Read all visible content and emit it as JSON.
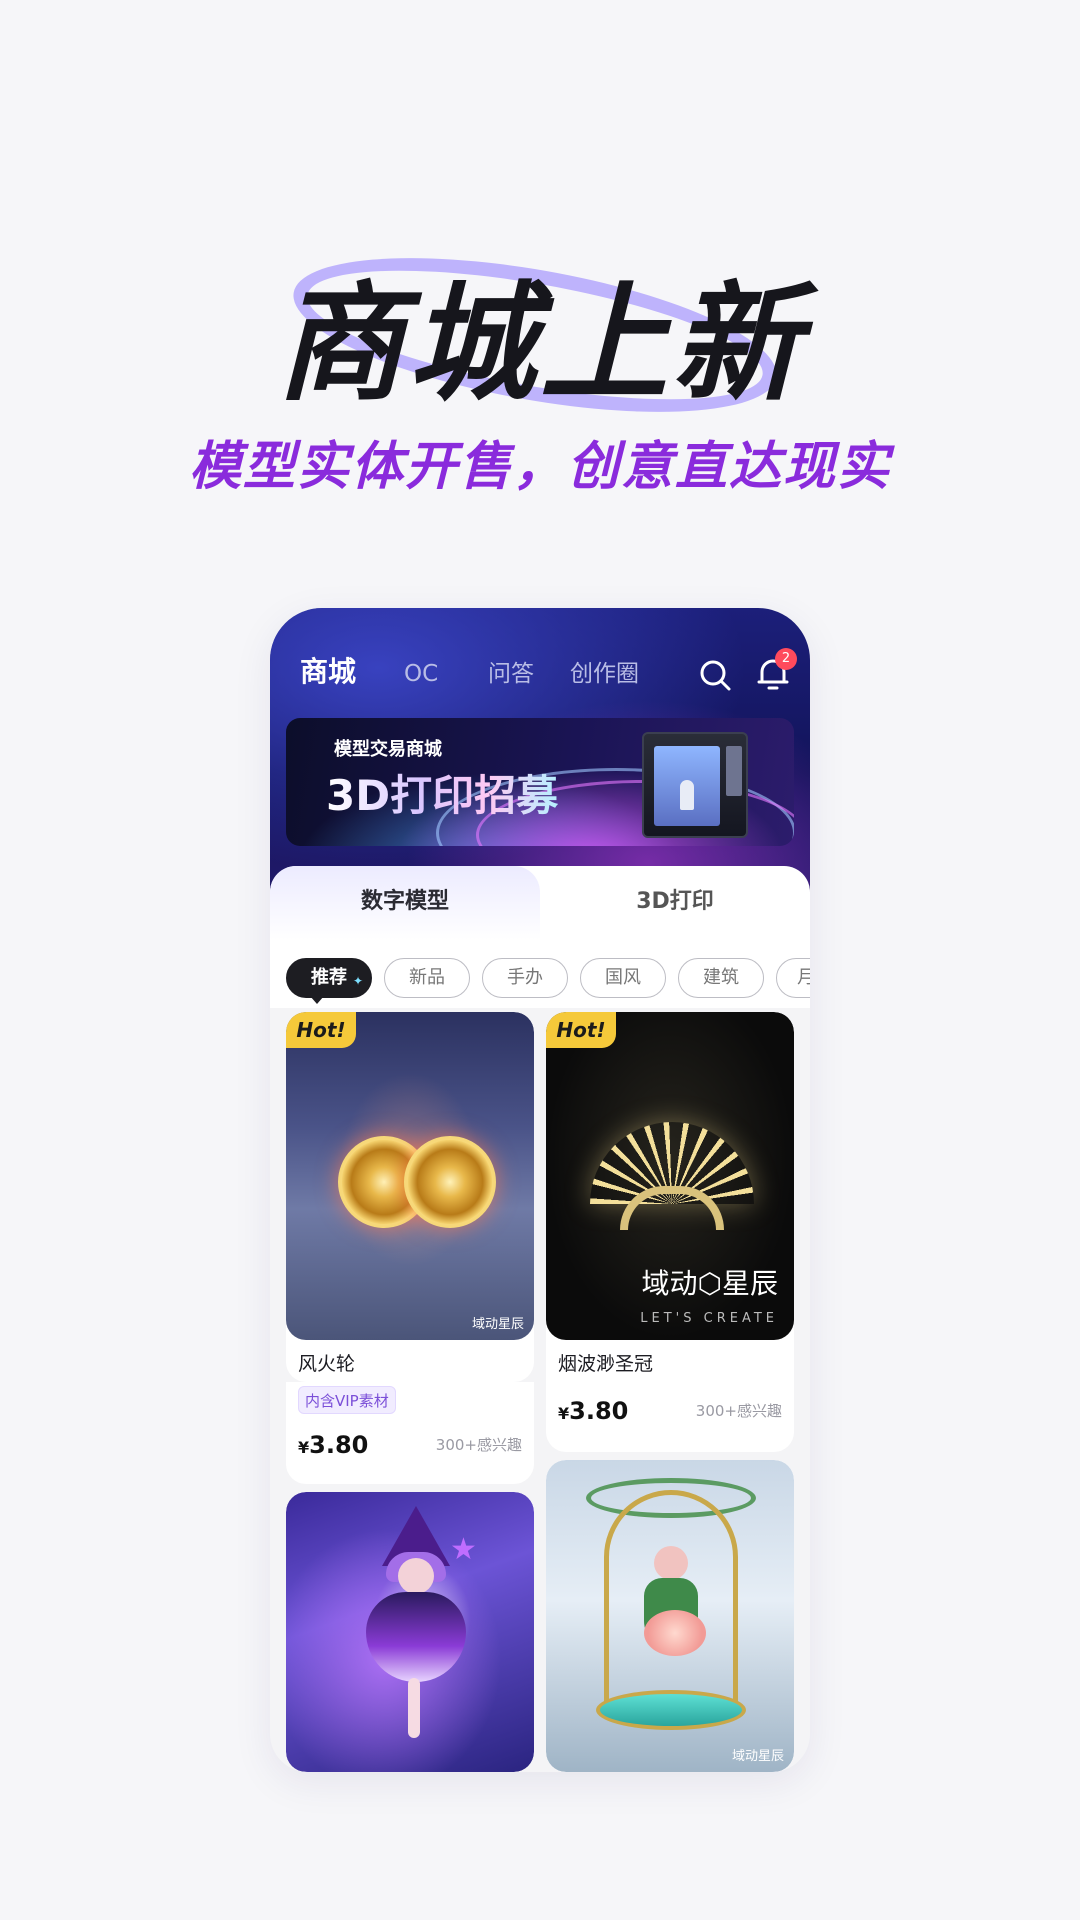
{
  "promo": {
    "title": "商城上新",
    "subtitle": "模型实体开售，创意直达现实"
  },
  "topnav": {
    "tabs": [
      {
        "label": "商城",
        "active": true
      },
      {
        "label": "OC"
      },
      {
        "label": "问答"
      },
      {
        "label": "创作圈"
      }
    ],
    "search_icon": "search-icon",
    "bell_icon": "bell-icon",
    "notification_count": "2"
  },
  "banner": {
    "small_text": "模型交易商城",
    "big_text": "3D打印招募"
  },
  "category_tabs": [
    {
      "label": "数字模型",
      "active": true
    },
    {
      "label": "3D打印"
    }
  ],
  "filters": [
    "推荐",
    "新品",
    "手办",
    "国风",
    "建筑",
    "月"
  ],
  "products": [
    {
      "hot": "Hot!",
      "title": "风火轮",
      "tag": "内含VIP素材",
      "price_symbol": "¥",
      "price": "3.80",
      "interest": "300+感兴趣",
      "watermark": "域动星辰"
    },
    {
      "hot": "Hot!",
      "title": "烟波渺圣冠",
      "price_symbol": "¥",
      "price": "3.80",
      "interest": "300+感兴趣",
      "brand": "域动⬡星辰",
      "brand_sub": "LET'S CREATE"
    },
    {
      "title": ""
    },
    {
      "watermark": "域动星辰"
    }
  ],
  "colors": {
    "accent_purple": "#8a2bdc",
    "hot_yellow": "#f5c93a",
    "badge_red": "#ff4a5c",
    "nav_dark": "#12145a"
  }
}
